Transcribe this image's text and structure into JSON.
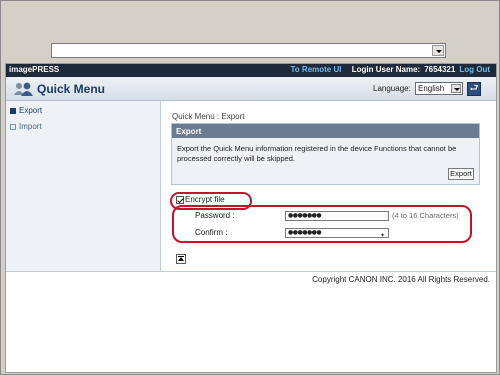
{
  "browser": {
    "address_value": ""
  },
  "header": {
    "brand": "imagePRESS",
    "remote_ui_link": "To Remote UI",
    "login_label": "Login User Name:",
    "login_value": "7654321",
    "logout_link": "Log Out"
  },
  "titlebar": {
    "title": "Quick Menu",
    "language_label": "Language:",
    "language_value": "English"
  },
  "sidebar": {
    "items": [
      {
        "label": "Export",
        "active": true
      },
      {
        "label": "Import",
        "active": false
      }
    ]
  },
  "main": {
    "breadcrumb": "Quick Menu : Export",
    "panel": {
      "heading": "Export",
      "text": "Export the Quick Menu information registered in the device Functions that cannot be processed correctly will be skipped.",
      "button": "Export"
    },
    "encrypt_label": "Encrypt file",
    "encrypt_checked": true,
    "password_label": "Password :",
    "password_value": "●●●●●●●",
    "password_hint": "(4 to 16 Characters)",
    "confirm_label": "Confirm :",
    "confirm_value": "●●●●●●●"
  },
  "footer": {
    "copyright": "Copyright CANON INC. 2016 All Rights Reserved."
  },
  "colors": {
    "header_bg": "#1e2a3a",
    "link": "#6fbde8",
    "highlight_ring": "#c8102e",
    "panel_head": "#6b7c91"
  }
}
